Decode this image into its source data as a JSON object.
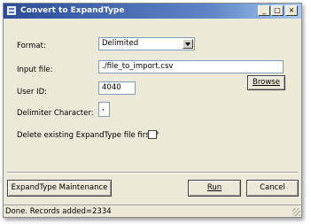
{
  "window": {
    "title": "Convert to ExpandType",
    "minimize_glyph": "_",
    "maximize_glyph": "□",
    "close_glyph": "×"
  },
  "form": {
    "format_label": "Format:",
    "format_value": "Delimited",
    "input_file_label": "Input file:",
    "input_file_value": "./file_to_import.csv",
    "browse_label": "Browse",
    "user_id_label": "User ID:",
    "user_id_value": "4040",
    "delimiter_label": "Delimiter Character:",
    "delimiter_value": ",",
    "delete_label": "Delete existing ExpandType file first ?",
    "delete_checked": false
  },
  "buttons": {
    "maintenance_label": "ExpandType Maintenance",
    "run_label": "Run",
    "cancel_label": "Cancel"
  },
  "status": {
    "text": "Done.  Records added=2334"
  }
}
